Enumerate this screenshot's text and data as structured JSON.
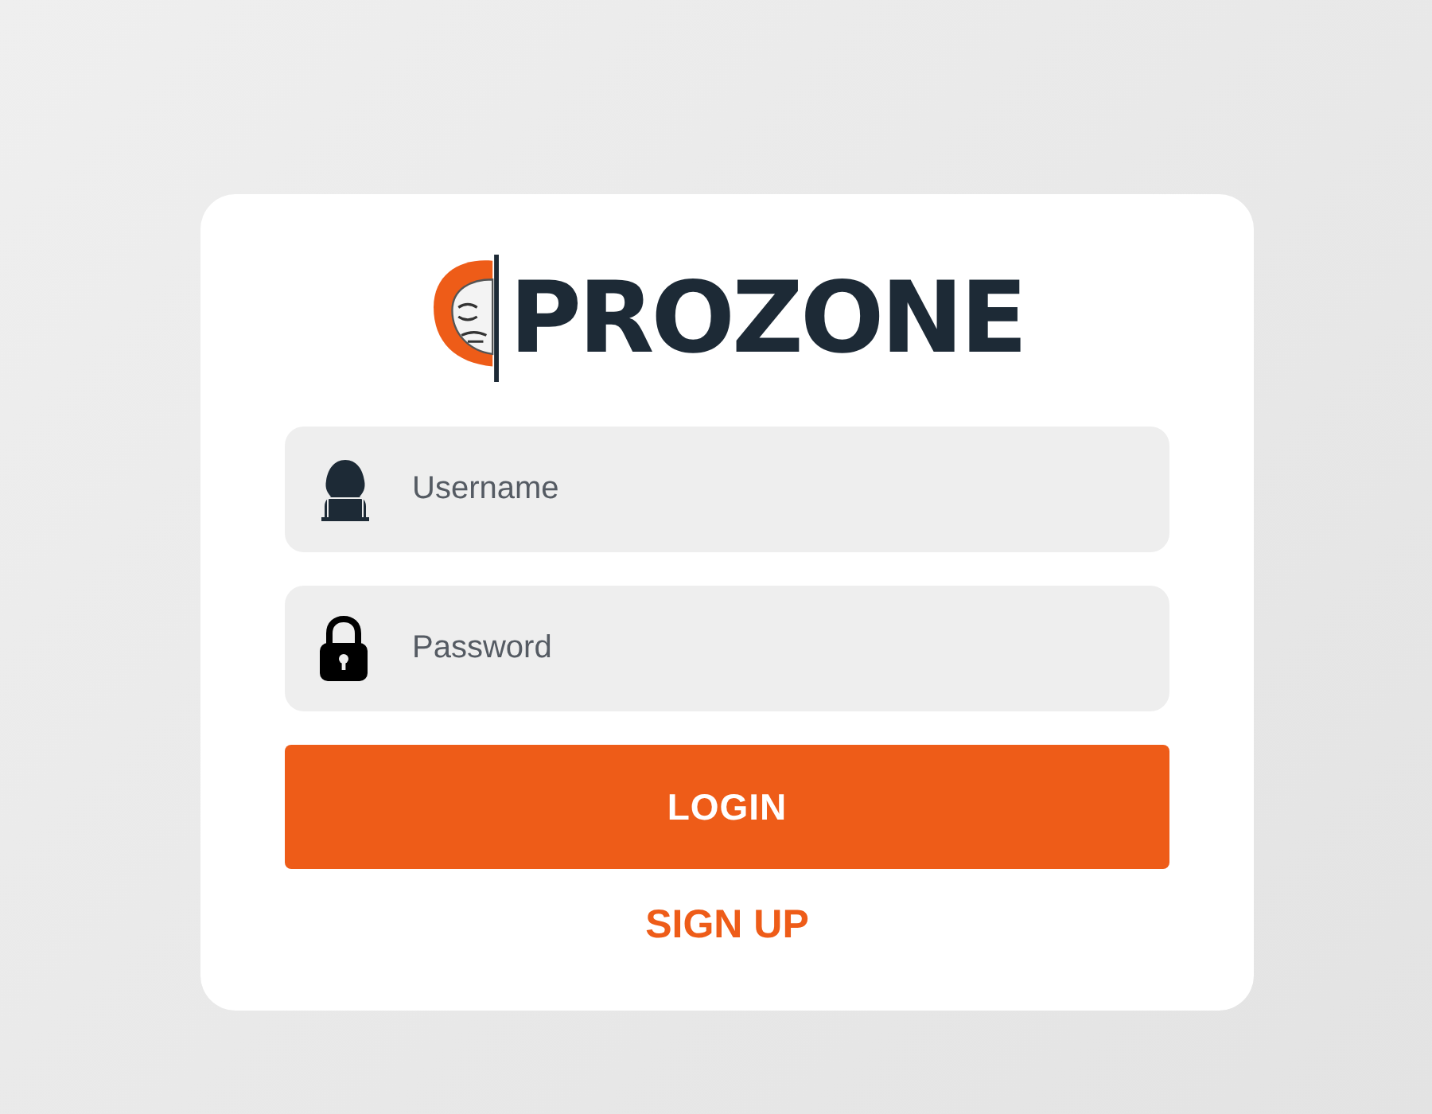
{
  "logo": {
    "text": "PROZONE"
  },
  "fields": [
    {
      "kind": "username",
      "placeholder": "Username"
    },
    {
      "kind": "password",
      "placeholder": "Password"
    }
  ],
  "login_button": {
    "label": "LOGIN"
  },
  "signup_link": {
    "label": "SIGN UP"
  }
}
